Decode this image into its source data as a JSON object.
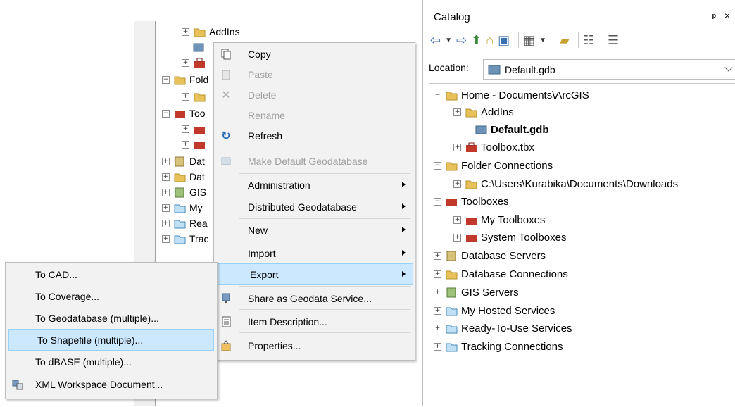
{
  "background_tree": {
    "items": [
      {
        "label": "AddIns"
      },
      {
        "label": "Fold"
      },
      {
        "label": "Too"
      },
      {
        "label": "Dat"
      },
      {
        "label": "Dat"
      },
      {
        "label": "GIS"
      },
      {
        "label": "My"
      },
      {
        "label": "Rea"
      },
      {
        "label": "Trac"
      }
    ]
  },
  "context_menu": {
    "items": [
      {
        "label": "Copy",
        "icon": "copy-icon",
        "enabled": true
      },
      {
        "label": "Paste",
        "icon": "paste-icon",
        "enabled": false
      },
      {
        "label": "Delete",
        "icon": "delete-icon",
        "enabled": false
      },
      {
        "label": "Rename",
        "icon": "",
        "enabled": false
      },
      {
        "label": "Refresh",
        "icon": "refresh-icon",
        "enabled": true
      },
      {
        "label": "Make Default Geodatabase",
        "icon": "default-gdb-icon",
        "enabled": false
      },
      {
        "label": "Administration",
        "icon": "",
        "enabled": true,
        "submenu": true
      },
      {
        "label": "Distributed Geodatabase",
        "icon": "",
        "enabled": true,
        "submenu": true
      },
      {
        "label": "New",
        "icon": "",
        "enabled": true,
        "submenu": true
      },
      {
        "label": "Import",
        "icon": "",
        "enabled": true,
        "submenu": true
      },
      {
        "label": "Export",
        "icon": "",
        "enabled": true,
        "submenu": true,
        "highlighted": true
      },
      {
        "label": "Share as Geodata Service...",
        "icon": "share-service-icon",
        "enabled": true
      },
      {
        "label": "Item Description...",
        "icon": "description-icon",
        "enabled": true
      },
      {
        "label": "Properties...",
        "icon": "properties-icon",
        "enabled": true
      }
    ]
  },
  "export_submenu": {
    "items": [
      {
        "label": "To CAD..."
      },
      {
        "label": "To Coverage..."
      },
      {
        "label": "To Geodatabase (multiple)..."
      },
      {
        "label": "To Shapefile (multiple)...",
        "highlighted": true
      },
      {
        "label": "To dBASE (multiple)..."
      },
      {
        "label": "XML Workspace Document...",
        "icon": "xml-workspace-icon"
      }
    ]
  },
  "catalog": {
    "title": "Catalog",
    "pin_glyph": "ᵖ",
    "close_glyph": "×",
    "location_label": "Location:",
    "location_value": "Default.gdb",
    "tree": [
      {
        "label": "Home - Documents\\ArcGIS",
        "expander": "−"
      },
      {
        "label": "AddIns",
        "expander": "+"
      },
      {
        "label": "Default.gdb",
        "expander": ""
      },
      {
        "label": "Toolbox.tbx",
        "expander": "+"
      },
      {
        "label": "Folder Connections",
        "expander": "−"
      },
      {
        "label": "C:\\Users\\Kurabika\\Documents\\Downloads",
        "expander": "+"
      },
      {
        "label": "Toolboxes",
        "expander": "−"
      },
      {
        "label": "My Toolboxes",
        "expander": "+"
      },
      {
        "label": "System Toolboxes",
        "expander": "+"
      },
      {
        "label": "Database Servers",
        "expander": "+"
      },
      {
        "label": "Database Connections",
        "expander": "+"
      },
      {
        "label": "GIS Servers",
        "expander": "+"
      },
      {
        "label": "My Hosted Services",
        "expander": "+"
      },
      {
        "label": "Ready-To-Use Services",
        "expander": "+"
      },
      {
        "label": "Tracking Connections",
        "expander": "+"
      }
    ]
  },
  "colors": {
    "highlight": "#cce8ff",
    "highlight_border": "#99d1ff",
    "menu_bg": "#f2f2f2",
    "folder": "#e8c15a",
    "toolbox": "#c0392b"
  }
}
